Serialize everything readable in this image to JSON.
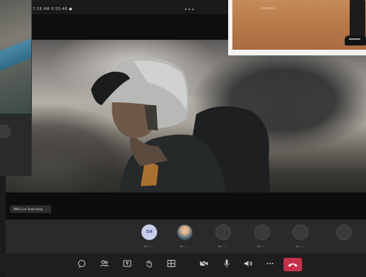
{
  "window": {
    "title": "7:19 AM  0:55:48  ●  ",
    "time": "▪ ▪ ▪"
  },
  "video": {
    "speaker_name": "MKB Live Shad Away",
    "chevron": "⌄"
  },
  "participants": [
    {
      "initials": "SH",
      "name": "SH... • •"
    },
    {
      "initials": "",
      "name": "SH... • •"
    },
    {
      "initials": "",
      "name": "SH... • •"
    },
    {
      "initials": "",
      "name": "SH... • •"
    },
    {
      "initials": "",
      "name": "SH... • •"
    },
    {
      "initials": "",
      "name": ""
    }
  ],
  "controls": [
    {
      "icon": "chat-icon"
    },
    {
      "icon": "people-icon"
    },
    {
      "icon": "raise-hand-icon"
    },
    {
      "icon": "reactions-icon"
    },
    {
      "icon": "view-icon"
    },
    {
      "icon": "camera-icon"
    },
    {
      "icon": "mic-icon"
    },
    {
      "icon": "speaker-icon"
    },
    {
      "icon": "more-icon"
    }
  ],
  "colors": {
    "end_call": "#c4314b",
    "avatar_initials_bg": "#c9cdea",
    "avatar_initials_fg": "#4a5396"
  }
}
